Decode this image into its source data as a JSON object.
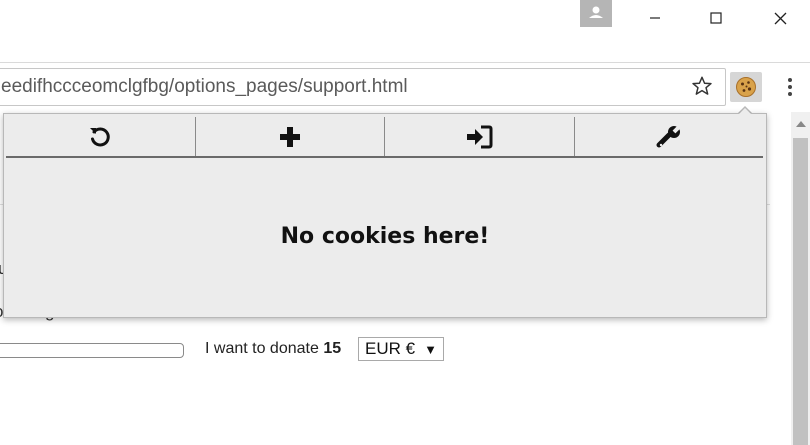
{
  "window": {
    "controls": {
      "profile_icon": "person-icon",
      "minimize_icon": "minimize-icon",
      "maximize_icon": "maximize-icon",
      "close_icon": "close-icon"
    }
  },
  "toolbar": {
    "url": "eedifhccceomclgfbg/options_pages/support.html",
    "bookmark_icon": "star-icon",
    "extension_icon": "cookie-icon",
    "menu_icon": "kebab-menu-icon"
  },
  "page": {
    "partial_line_a": "u",
    "partial_line_b": "o change the amount",
    "donate_prefix": "I want to donate",
    "donate_amount": "15",
    "currency_selected": "EUR €"
  },
  "popup": {
    "buttons": [
      {
        "icon": "refresh-icon"
      },
      {
        "icon": "plus-icon"
      },
      {
        "icon": "sign-in-icon"
      },
      {
        "icon": "wrench-icon"
      }
    ],
    "message": "No cookies here!"
  },
  "colors": {
    "popup_bg": "#ececec",
    "extension_button_bg": "#d6d6d6",
    "profile_bg": "#b5b5b5"
  }
}
